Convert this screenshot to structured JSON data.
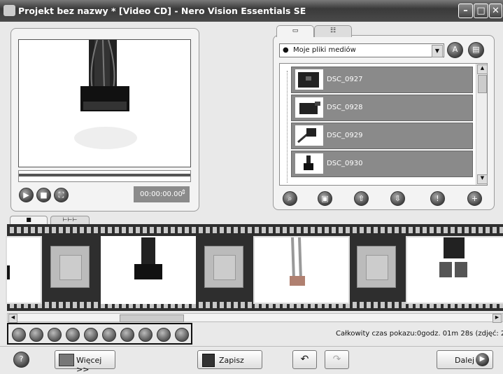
{
  "window": {
    "title": "Projekt bez nazwy * [Video CD] - Nero Vision Essentials SE"
  },
  "preview": {
    "timecode": "00:00:00.00"
  },
  "media": {
    "source": "Moje pliki mediów",
    "items": [
      {
        "label": "DSC_0927"
      },
      {
        "label": "DSC_0928"
      },
      {
        "label": "DSC_0929"
      },
      {
        "label": "DSC_0930"
      }
    ]
  },
  "status": {
    "total_time": "Całkowity czas pokazu:0godz. 01m 28s (zdjęć: 22)"
  },
  "buttons": {
    "more": "Więcej >>",
    "save": "Zapisz",
    "next": "Dalej"
  },
  "icons": {
    "app": "app-icon",
    "minimize": "minimize-icon",
    "maximize": "maximize-icon",
    "close": "close-icon",
    "play": "play-icon",
    "stop": "stop-icon",
    "fullscreen": "fullscreen-icon",
    "help": "help-icon",
    "undo": "undo-icon",
    "redo": "redo-icon",
    "save": "floppy-icon",
    "next": "arrow-right-icon"
  },
  "colors": {
    "titlebar": "#3a3a3a",
    "media_item": "#8a8a8a",
    "film": "#2e2e2e"
  }
}
